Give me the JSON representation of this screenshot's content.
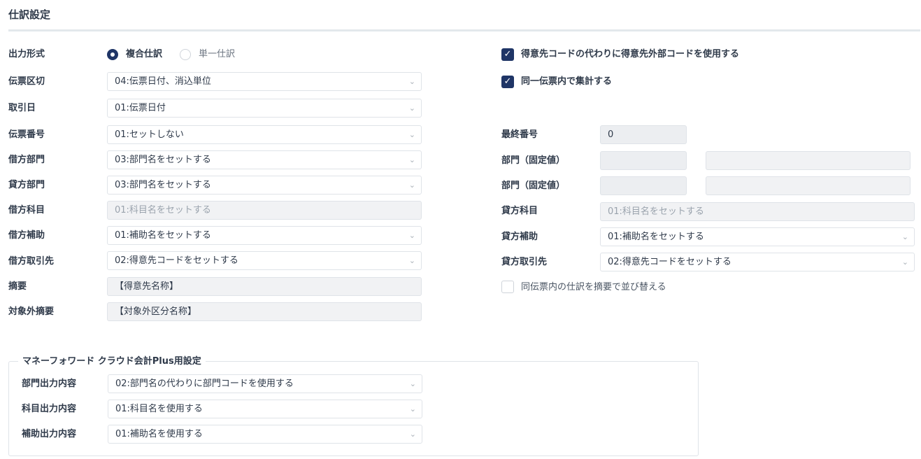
{
  "header": {
    "title": "仕訳設定"
  },
  "output_format": {
    "label": "出力形式",
    "options": [
      {
        "label": "複合仕訳",
        "selected": true
      },
      {
        "label": "単一仕訳",
        "selected": false
      }
    ]
  },
  "left_fields": {
    "voucher_break": {
      "label": "伝票区切",
      "value": "04:伝票日付、消込単位"
    },
    "trade_date": {
      "label": "取引日",
      "value": "01:伝票日付"
    },
    "voucher_no": {
      "label": "伝票番号",
      "value": "01:セットしない"
    },
    "debit_dept": {
      "label": "借方部門",
      "value": "03:部門名をセットする"
    },
    "credit_dept": {
      "label": "貸方部門",
      "value": "03:部門名をセットする"
    },
    "debit_account": {
      "label": "借方科目",
      "value": "01:科目名をセットする"
    },
    "debit_sub": {
      "label": "借方補助",
      "value": "01:補助名をセットする"
    },
    "debit_partner": {
      "label": "借方取引先",
      "value": "02:得意先コードをセットする"
    },
    "memo": {
      "label": "摘要",
      "value": "【得意先名称】"
    },
    "excluded_memo": {
      "label": "対象外摘要",
      "value": "【対象外区分名称】"
    }
  },
  "right_options": {
    "use_external_code": {
      "label": "得意先コードの代わりに得意先外部コードを使用する",
      "checked": true
    },
    "aggregate": {
      "label": "同一伝票内で集計する",
      "checked": true
    },
    "sort_by_memo": {
      "label": "同伝票内の仕訳を摘要で並び替える",
      "checked": false
    }
  },
  "right_fields": {
    "last_number": {
      "label": "最終番号",
      "value": "0"
    },
    "dept_fixed_1": {
      "label": "部門（固定値）",
      "value": ""
    },
    "dept_fixed_2": {
      "label": "部門（固定値）",
      "value": ""
    },
    "credit_account": {
      "label": "貸方科目",
      "value": "01:科目名をセットする"
    },
    "credit_sub": {
      "label": "貸方補助",
      "value": "01:補助名をセットする"
    },
    "credit_partner": {
      "label": "貸方取引先",
      "value": "02:得意先コードをセットする"
    }
  },
  "mf_section": {
    "legend": "マネーフォワード クラウド会計Plus用設定",
    "dept_output": {
      "label": "部門出力内容",
      "value": "02:部門名の代わりに部門コードを使用する"
    },
    "account_output": {
      "label": "科目出力内容",
      "value": "01:科目名を使用する"
    },
    "sub_output": {
      "label": "補助出力内容",
      "value": "01:補助名を使用する"
    }
  },
  "icons": {
    "chevron": "⌄",
    "check": "✓"
  },
  "colors": {
    "accent": "#1f3566",
    "border": "#dfe3e8",
    "disabled_bg": "#f1f2f4"
  }
}
